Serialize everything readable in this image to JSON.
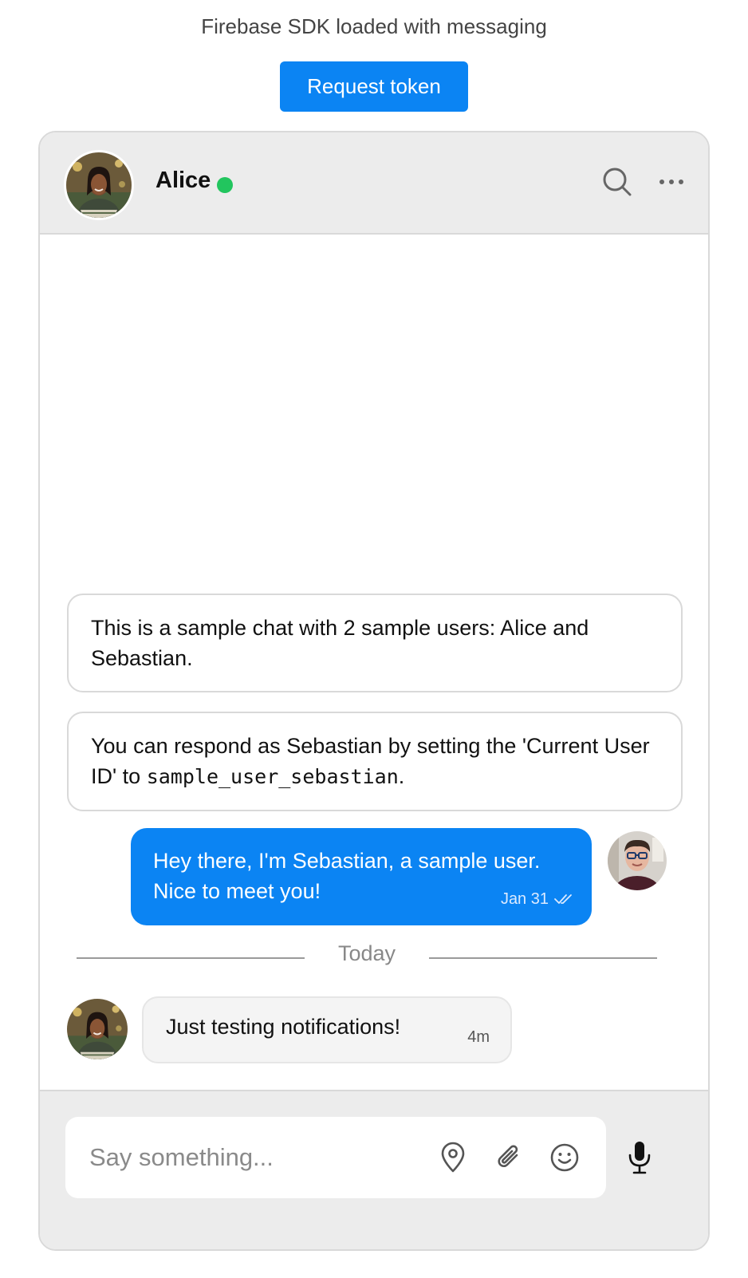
{
  "page": {
    "sdk_status": "Firebase SDK loaded with messaging",
    "request_button": "Request token"
  },
  "chat": {
    "header": {
      "contact_name": "Alice",
      "online": true,
      "icons": [
        "search-icon",
        "more-icon"
      ]
    },
    "messages": [
      {
        "kind": "system",
        "text": "This is a sample chat with 2 sample users: Alice and Sebastian."
      },
      {
        "kind": "system",
        "text_before": "You can respond as Sebastian by setting the 'Current User ID' to ",
        "code": "sample_user_sebastian",
        "text_after": "."
      },
      {
        "kind": "outgoing",
        "author": "Sebastian",
        "text": "Hey there, I'm Sebastian, a sample user. Nice to meet you!",
        "time": "Jan 31",
        "status_icon": "double-check-icon"
      },
      {
        "kind": "incoming",
        "author": "Alice",
        "text": "Just testing notifications!",
        "time": "4m"
      }
    ],
    "date_divider": "Today",
    "composer": {
      "placeholder": "Say something...",
      "icons": [
        "location-pin-icon",
        "paperclip-icon",
        "emoji-icon",
        "microphone-icon"
      ]
    }
  },
  "colors": {
    "accent": "#0b84f3",
    "online": "#22c55e",
    "header_bg": "#ececec"
  }
}
